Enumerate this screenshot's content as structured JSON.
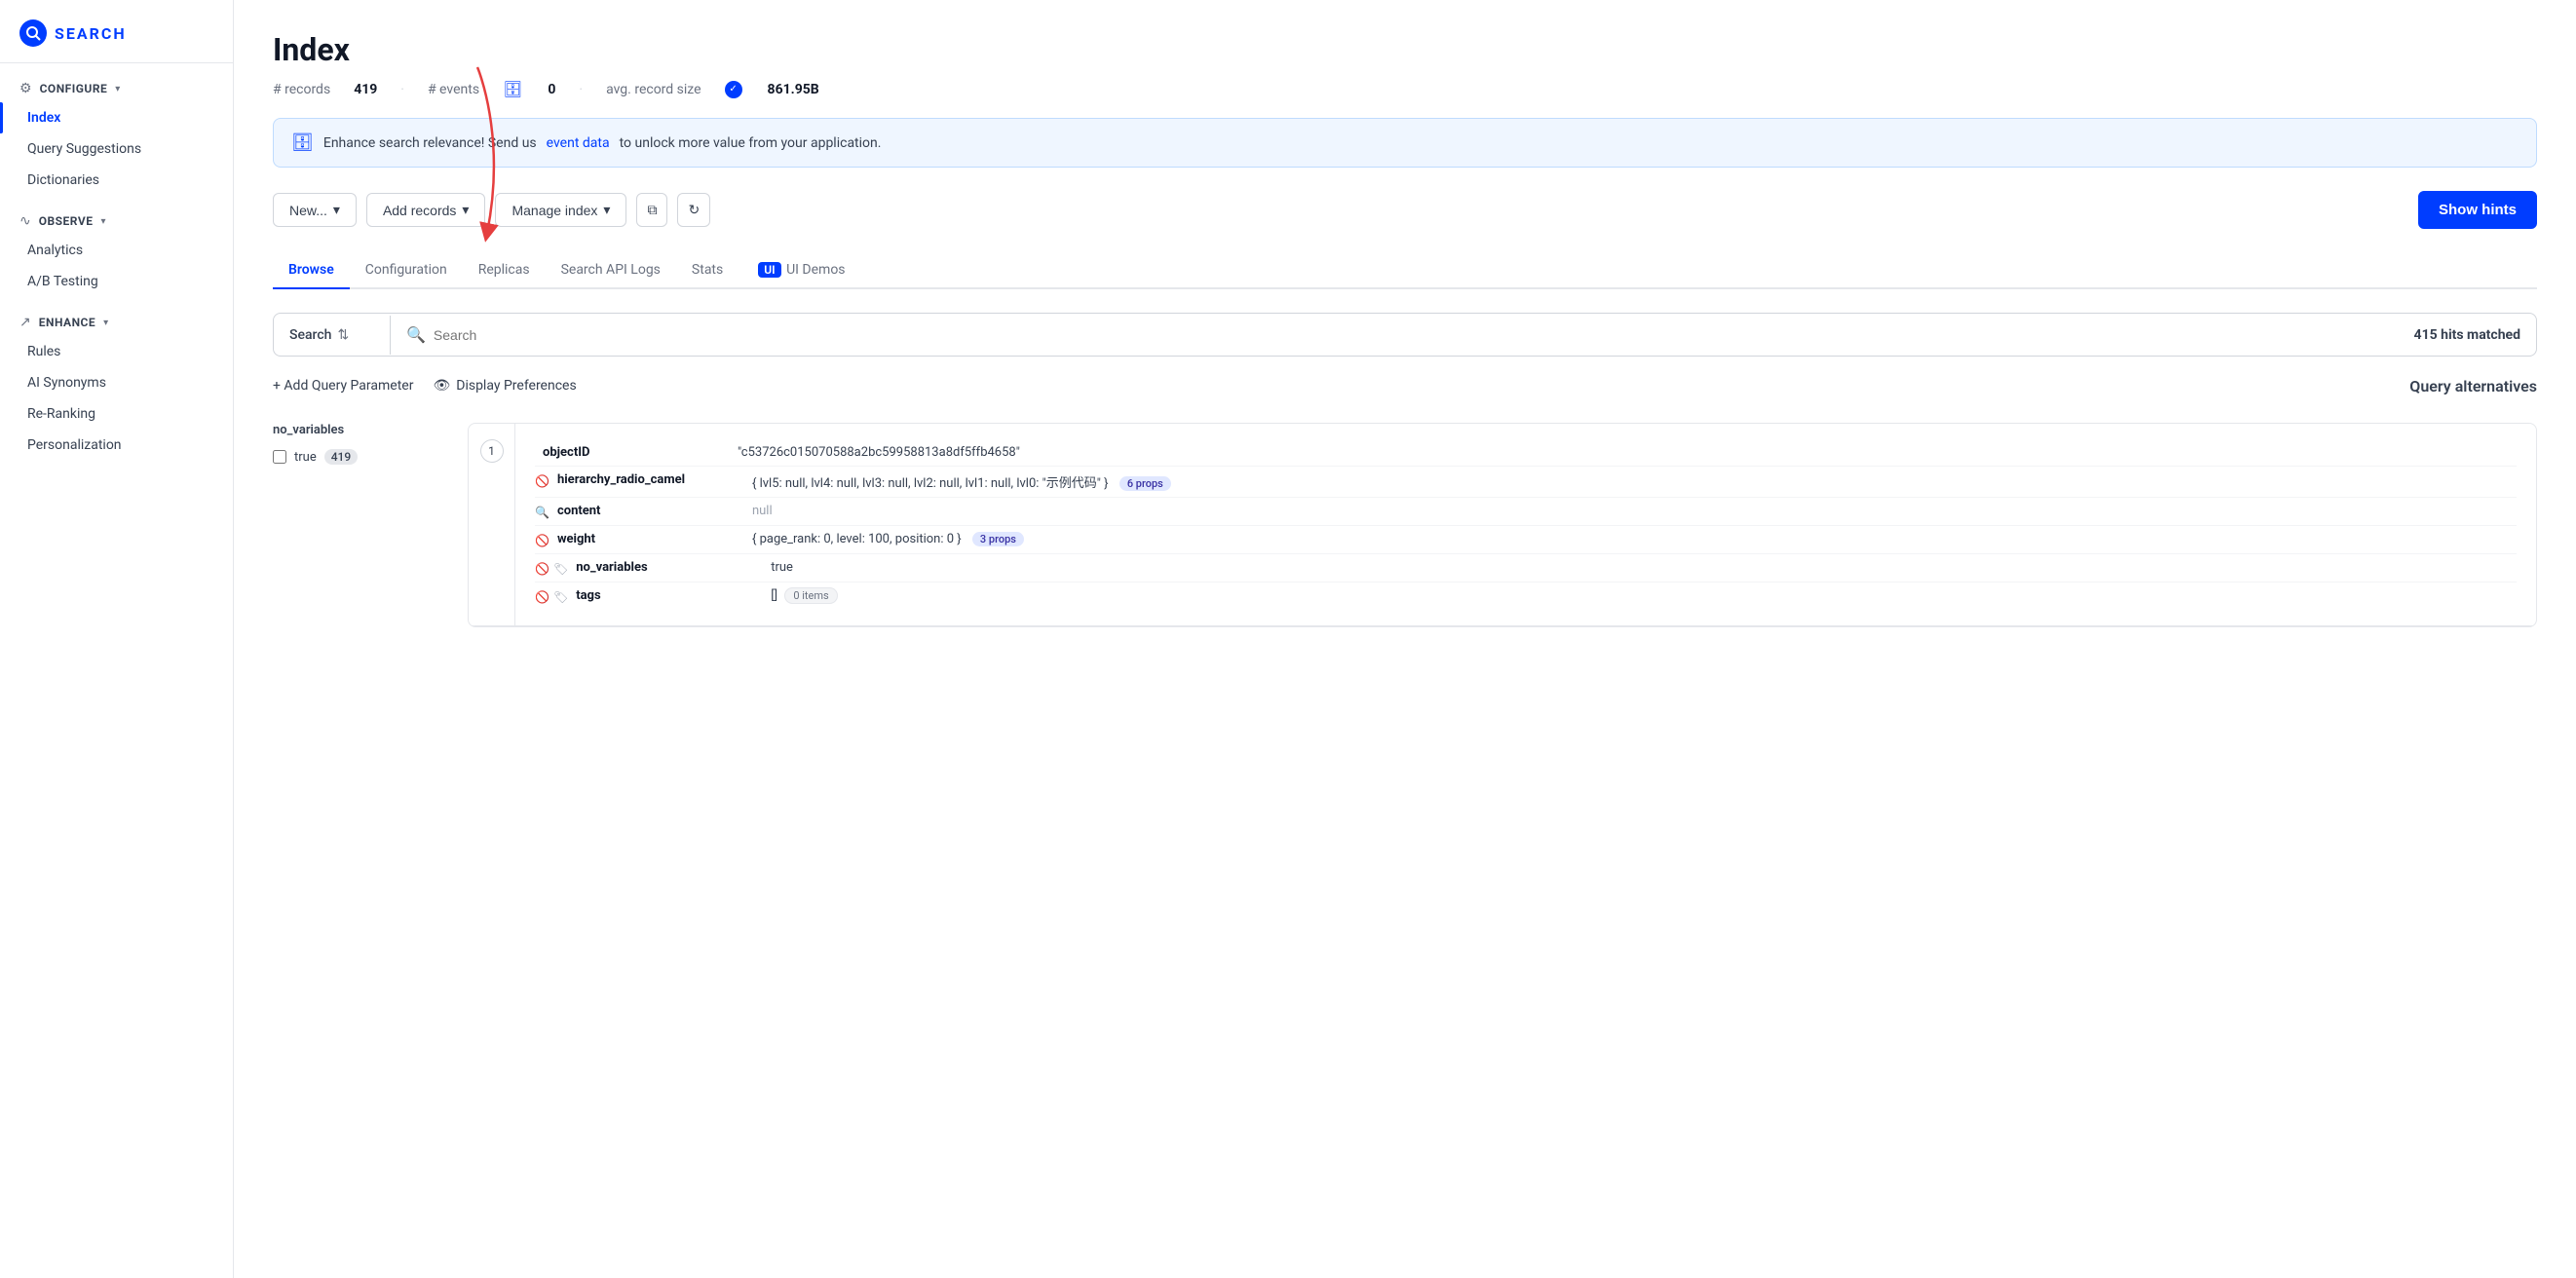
{
  "app": {
    "name": "SEARCH"
  },
  "sidebar": {
    "configure_label": "CONFIGURE",
    "items_configure": [
      {
        "id": "index",
        "label": "Index",
        "active": true
      },
      {
        "id": "query-suggestions",
        "label": "Query Suggestions",
        "active": false
      },
      {
        "id": "dictionaries",
        "label": "Dictionaries",
        "active": false
      }
    ],
    "observe_label": "OBSERVE",
    "items_observe": [
      {
        "id": "analytics",
        "label": "Analytics",
        "active": false
      },
      {
        "id": "ab-testing",
        "label": "A/B Testing",
        "active": false
      }
    ],
    "enhance_label": "ENHANCE",
    "items_enhance": [
      {
        "id": "rules",
        "label": "Rules",
        "active": false
      },
      {
        "id": "ai-synonyms",
        "label": "AI Synonyms",
        "active": false
      },
      {
        "id": "re-ranking",
        "label": "Re-Ranking",
        "active": false
      },
      {
        "id": "personalization",
        "label": "Personalization",
        "active": false
      }
    ]
  },
  "main": {
    "page_title": "Index",
    "stats": {
      "records_label": "# records",
      "records_value": "419",
      "events_label": "# events",
      "events_value": "0",
      "avg_size_label": "avg. record size",
      "avg_size_value": "861.95B"
    },
    "banner": {
      "text_before": "Enhance search relevance! Send us ",
      "link_text": "event data",
      "text_after": " to unlock more value from your application."
    },
    "toolbar": {
      "new_label": "New...",
      "add_records_label": "Add records",
      "manage_index_label": "Manage index",
      "show_hints_label": "Show hints"
    },
    "tabs": [
      {
        "id": "browse",
        "label": "Browse",
        "active": true
      },
      {
        "id": "configuration",
        "label": "Configuration",
        "active": false
      },
      {
        "id": "replicas",
        "label": "Replicas",
        "active": false
      },
      {
        "id": "search-api-logs",
        "label": "Search API Logs",
        "active": false
      },
      {
        "id": "stats",
        "label": "Stats",
        "active": false
      },
      {
        "id": "ui-demos",
        "label": "UI Demos",
        "badge": "UI",
        "active": false
      }
    ],
    "search": {
      "type": "Search",
      "placeholder": "Search",
      "hits_matched": "415 hits matched"
    },
    "query_params": {
      "add_param_label": "+ Add Query Parameter",
      "display_pref_label": "Display Preferences",
      "query_alternatives_label": "Query alternatives"
    },
    "facets": {
      "group_title": "no_variables",
      "items": [
        {
          "label": "true",
          "count": "419",
          "checked": false
        }
      ]
    },
    "record": {
      "number": "1",
      "fields": [
        {
          "name": "objectID",
          "value": "\"c53726c015070588a2bc59958813a8df5ffb4658\"",
          "icons": [],
          "type": "string"
        },
        {
          "name": "hierarchy_radio_camel",
          "value": "{ lvl5: null, lvl4: null, lvl3: null, lvl2: null, lvl1: null, lvl0: \"示例代码\" }",
          "icons": [
            "eye-off",
            ""
          ],
          "badge": "6 props",
          "type": "object"
        },
        {
          "name": "content",
          "value": "null",
          "icons": [
            "search"
          ],
          "type": "null"
        },
        {
          "name": "weight",
          "value": "{ page_rank: 0, level: 100, position: 0 }",
          "icons": [
            "eye-off",
            ""
          ],
          "badge": "3 props",
          "type": "object"
        },
        {
          "name": "no_variables",
          "value": "true",
          "icons": [
            "eye-off",
            "tag"
          ],
          "type": "boolean"
        },
        {
          "name": "tags",
          "value": "[]",
          "icons": [
            "eye-off",
            "tag"
          ],
          "items_badge": "0 items",
          "type": "array"
        }
      ]
    }
  }
}
